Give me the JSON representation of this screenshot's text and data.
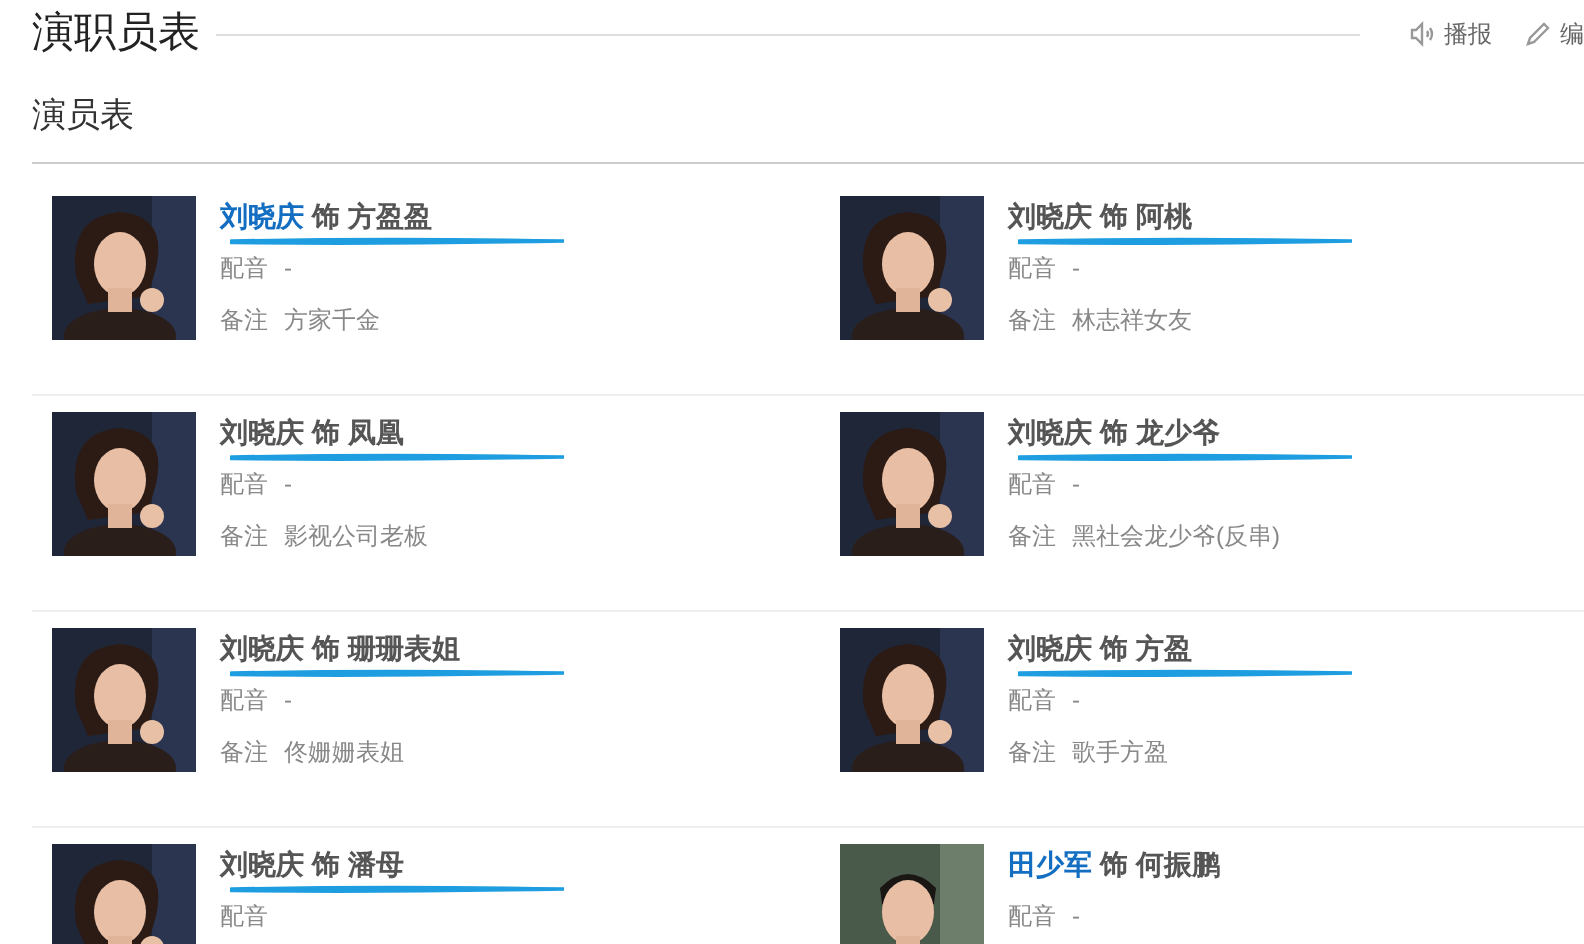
{
  "header": {
    "title": "演职员表",
    "actions": [
      {
        "kind": "speaker",
        "label": "播报"
      },
      {
        "kind": "edit",
        "label": "编"
      }
    ]
  },
  "section": {
    "title": "演员表"
  },
  "cast": [
    {
      "actor": "刘晓庆",
      "linked": true,
      "separator": "饰",
      "role": "方盈盈",
      "dub_label": "配音",
      "dub": "-",
      "note_label": "备注",
      "note": "方家千金",
      "marked": true
    },
    {
      "actor": "刘晓庆",
      "linked": false,
      "separator": "饰",
      "role": "阿桃",
      "dub_label": "配音",
      "dub": "-",
      "note_label": "备注",
      "note": "林志祥女友",
      "marked": true
    },
    {
      "actor": "刘晓庆",
      "linked": false,
      "separator": "饰",
      "role": "凤凰",
      "dub_label": "配音",
      "dub": "-",
      "note_label": "备注",
      "note": "影视公司老板",
      "marked": true
    },
    {
      "actor": "刘晓庆",
      "linked": false,
      "separator": "饰",
      "role": "龙少爷",
      "dub_label": "配音",
      "dub": "-",
      "note_label": "备注",
      "note": "黑社会龙少爷(反串)",
      "marked": true
    },
    {
      "actor": "刘晓庆",
      "linked": false,
      "separator": "饰",
      "role": "珊珊表姐",
      "dub_label": "配音",
      "dub": "-",
      "note_label": "备注",
      "note": "佟姗姗表姐",
      "marked": true
    },
    {
      "actor": "刘晓庆",
      "linked": false,
      "separator": "饰",
      "role": "方盈",
      "dub_label": "配音",
      "dub": "-",
      "note_label": "备注",
      "note": "歌手方盈",
      "marked": true
    },
    {
      "actor": "刘晓庆",
      "linked": false,
      "separator": "饰",
      "role": "潘母",
      "dub_label": "配音",
      "marked": true
    },
    {
      "actor": "田少军",
      "linked": true,
      "separator": "饰",
      "role": "何振鹏",
      "dub_label": "配音",
      "dub": "-",
      "marked": false
    }
  ]
}
